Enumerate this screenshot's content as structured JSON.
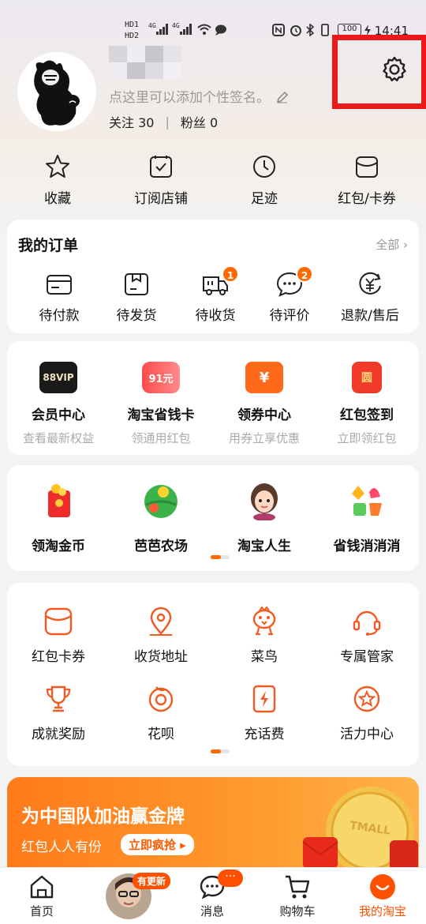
{
  "status_bar": {
    "left_indicators": [
      "HD1",
      "HD2",
      "4G",
      "4G"
    ],
    "battery": "100",
    "time": "14:41"
  },
  "profile": {
    "signature_placeholder": "点这里可以添加个性签名。",
    "following_label": "关注",
    "following_count": "30",
    "separator": "|",
    "fans_label": "粉丝",
    "fans_count": "0"
  },
  "quick_links": [
    {
      "label": "收藏",
      "icon": "star-icon"
    },
    {
      "label": "订阅店铺",
      "icon": "checkbox-icon"
    },
    {
      "label": "足迹",
      "icon": "clock-icon"
    },
    {
      "label": "红包/卡券",
      "icon": "coupon-icon"
    }
  ],
  "orders": {
    "title": "我的订单",
    "more": "全部 ›",
    "items": [
      {
        "label": "待付款",
        "icon": "wallet-icon"
      },
      {
        "label": "待发货",
        "icon": "box-icon"
      },
      {
        "label": "待收货",
        "icon": "truck-icon",
        "badge": "1"
      },
      {
        "label": "待评价",
        "icon": "comment-icon",
        "badge": "2"
      },
      {
        "label": "退款/售后",
        "icon": "refund-icon"
      }
    ]
  },
  "vip_items": [
    {
      "title": "会员中心",
      "subtitle": "查看最新权益",
      "icon_text": "88VIP"
    },
    {
      "title": "淘宝省钱卡",
      "subtitle": "领通用红包",
      "icon_text": "91元"
    },
    {
      "title": "领券中心",
      "subtitle": "用券立享优惠",
      "icon_text": "¥"
    },
    {
      "title": "红包签到",
      "subtitle": "立即领红包",
      "icon_text": "圆"
    }
  ],
  "games": [
    {
      "label": "领淘金币"
    },
    {
      "label": "芭芭农场"
    },
    {
      "label": "淘宝人生"
    },
    {
      "label": "省钱消消消"
    }
  ],
  "services": [
    {
      "label": "红包卡券",
      "icon": "coupon-icon"
    },
    {
      "label": "收货地址",
      "icon": "location-pin-icon"
    },
    {
      "label": "菜鸟",
      "icon": "cainiao-bird-icon"
    },
    {
      "label": "专属管家",
      "icon": "headset-icon"
    },
    {
      "label": "成就奖励",
      "icon": "trophy-icon"
    },
    {
      "label": "花呗",
      "icon": "huabei-icon"
    },
    {
      "label": "充话费",
      "icon": "phone-charge-icon"
    },
    {
      "label": "活力中心",
      "icon": "star-circle-icon"
    }
  ],
  "banner": {
    "title": "为中国队加油赢金牌",
    "subtitle": "红包人人有份",
    "button": "立即疯抢 ▸",
    "coin_text": "TMALL"
  },
  "tabbar": [
    {
      "label": "首页"
    },
    {
      "label": "",
      "badge": "有更新"
    },
    {
      "label": "消息",
      "badge": "···"
    },
    {
      "label": "购物车"
    },
    {
      "label": "我的淘宝"
    }
  ],
  "colors": {
    "accent": "#ff5000",
    "highlight_box": "#ea1a1a",
    "card_bg": "#ffffff",
    "page_bg": "#f3f3f3"
  }
}
